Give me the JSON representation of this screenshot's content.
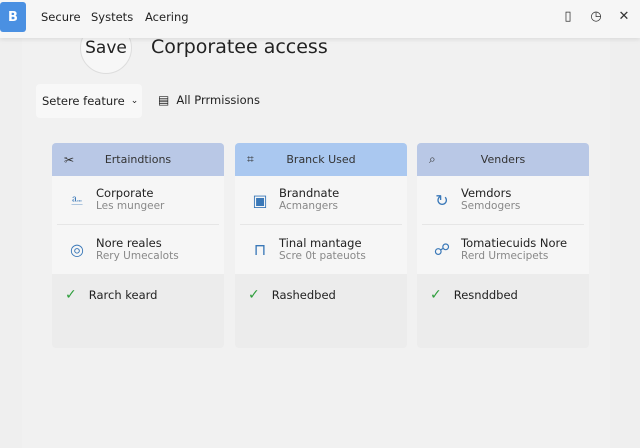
{
  "topbar": {
    "logo": "B",
    "nav": [
      "Secure",
      "Systets",
      "Acering"
    ],
    "icons": [
      "clipboard-icon",
      "clock-icon",
      "close-icon"
    ]
  },
  "header": {
    "save_label": "Save",
    "title": "Corporatee access"
  },
  "filters": {
    "select_value": "Setere feature",
    "permissions_label": "All Prrmissions"
  },
  "colors": {
    "header_blue": "#b9c8e6",
    "header_active": "#aac8f0",
    "check": "#2e9e3c",
    "icon": "#3a78b8"
  },
  "cards": [
    {
      "header": "Ertaindtions",
      "header_icon": "tools-icon",
      "rows": [
        {
          "title": "Corporate",
          "sub": "Les mungeer",
          "icon": "inbox-icon"
        },
        {
          "title": "Nore reales",
          "sub": "Rery Umecalots",
          "icon": "badge-icon"
        }
      ],
      "footer": "Rarch keard"
    },
    {
      "header": "Branck Used",
      "header_icon": "crop-icon",
      "rows": [
        {
          "title": "Brandnate",
          "sub": "Acmangers",
          "icon": "image-icon"
        },
        {
          "title": "Tinal mantage",
          "sub": "Scre 0t pateuots",
          "icon": "pillars-icon"
        }
      ],
      "footer": "Rashedbed"
    },
    {
      "header": "Venders",
      "header_icon": "search-icon",
      "rows": [
        {
          "title": "Vemdors",
          "sub": "Semdogers",
          "icon": "refresh-icon"
        },
        {
          "title": "Tomatiecuids Nore",
          "sub": "Rerd Urmecipets",
          "icon": "network-icon"
        }
      ],
      "footer": "Resnddbed"
    }
  ]
}
